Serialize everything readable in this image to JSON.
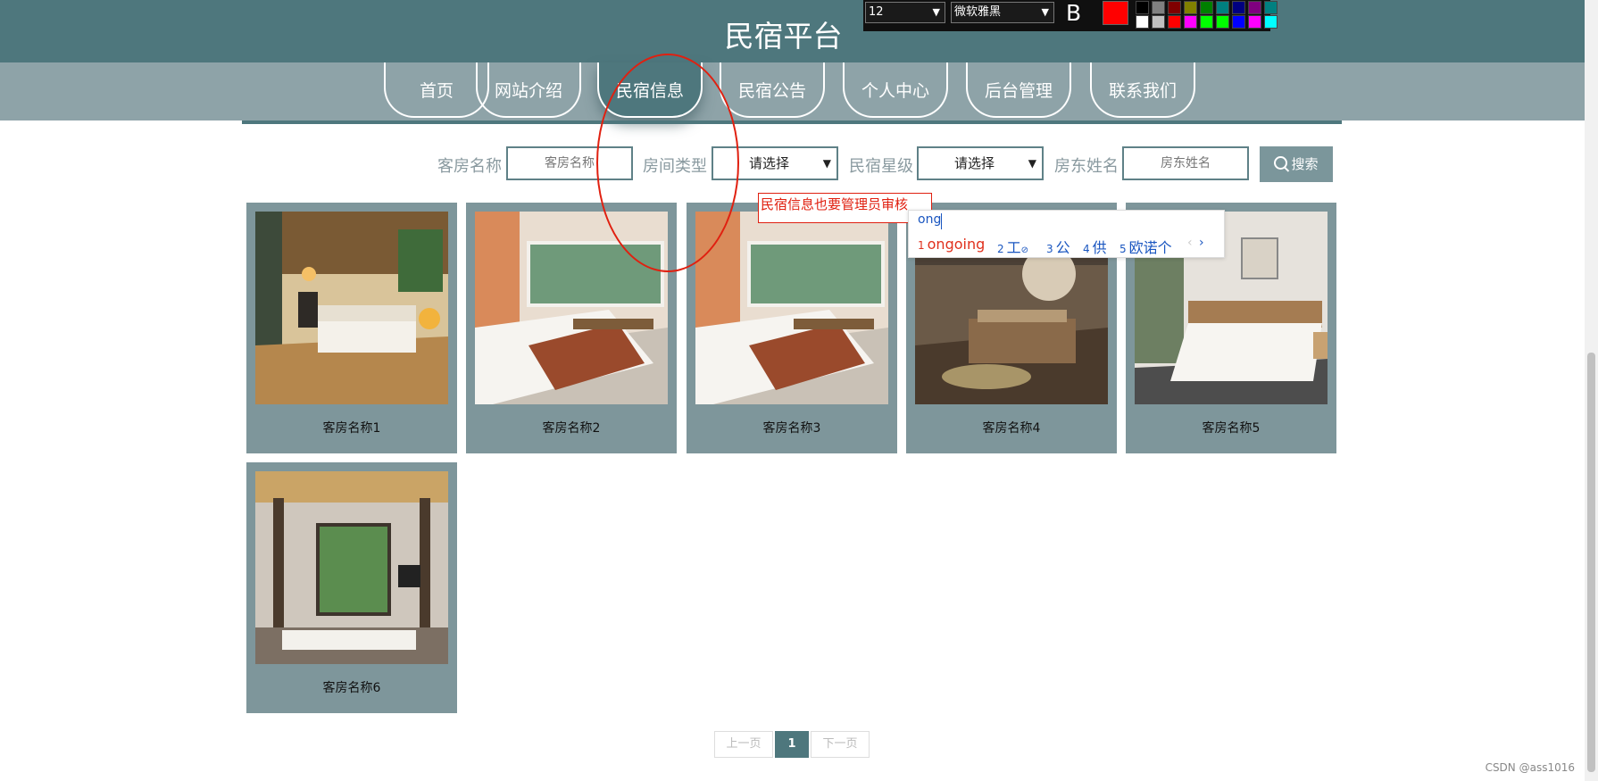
{
  "site": {
    "title": "民宿平台"
  },
  "nav": {
    "items": [
      {
        "label": "首页"
      },
      {
        "label": "网站介绍"
      },
      {
        "label": "民宿信息",
        "active": true
      },
      {
        "label": "民宿公告"
      },
      {
        "label": "个人中心"
      },
      {
        "label": "后台管理"
      },
      {
        "label": "联系我们"
      }
    ]
  },
  "search": {
    "room_name_label": "客房名称",
    "room_name_placeholder": "客房名称",
    "room_type_label": "房间类型",
    "room_type_value": "请选择",
    "star_label": "民宿星级",
    "star_value": "请选择",
    "landlord_label": "房东姓名",
    "landlord_placeholder": "房东姓名",
    "button_label": "搜索",
    "button_icon": "search-icon"
  },
  "rooms": [
    {
      "name": "客房名称1"
    },
    {
      "name": "客房名称2"
    },
    {
      "name": "客房名称3"
    },
    {
      "name": "客房名称4"
    },
    {
      "name": "客房名称5"
    },
    {
      "name": "客房名称6"
    }
  ],
  "pagination": {
    "prev": "上一页",
    "current": "1",
    "next": "下一页"
  },
  "annotation": {
    "note": "民宿信息也要管理员审核",
    "toolbar": {
      "font_size": "12",
      "font_family": "微软雅黑",
      "bold": "B",
      "current_color": "#ff0000",
      "palette_row1": [
        "#000000",
        "#808080",
        "#800000",
        "#808000",
        "#008000",
        "#008080",
        "#000080",
        "#800080",
        "#008080"
      ],
      "palette_row2": [
        "#ffffff",
        "#c0c0c0",
        "#ff0000",
        "#ff00ff",
        "#00ff00",
        "#00ff00",
        "#0000ff",
        "#ff00ff",
        "#00ffff"
      ]
    }
  },
  "ime": {
    "composition": "ong",
    "candidates": [
      {
        "num": "1",
        "text": "ongoing"
      },
      {
        "num": "2",
        "text": "工"
      },
      {
        "num": "3",
        "text": "公"
      },
      {
        "num": "4",
        "text": "供"
      },
      {
        "num": "5",
        "text": "欧诺个"
      }
    ],
    "prev": "‹",
    "next": "›"
  },
  "watermark": "CSDN @ass1016"
}
